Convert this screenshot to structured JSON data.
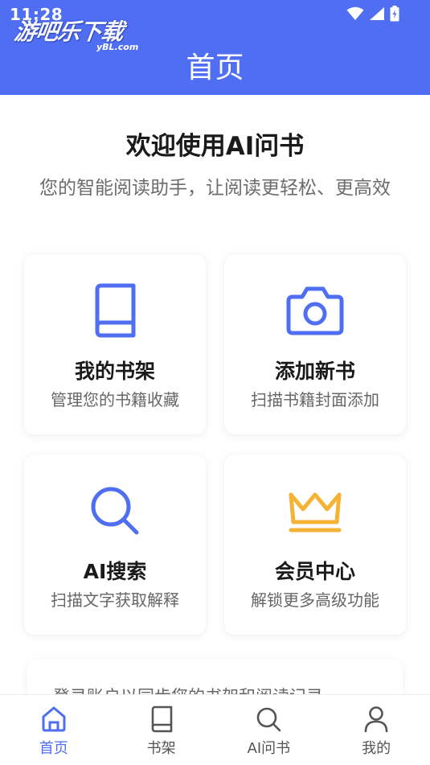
{
  "status_bar": {
    "time": "11:28",
    "watermark": "游吧乐下载",
    "watermark_sub": "yBL.com"
  },
  "header": {
    "title": "首页"
  },
  "welcome": {
    "title": "欢迎使用AI问书",
    "subtitle": "您的智能阅读助手，让阅读更轻松、更高效"
  },
  "cards": [
    {
      "icon": "book-icon",
      "title": "我的书架",
      "desc": "管理您的书籍收藏",
      "color": "#4f6ef2"
    },
    {
      "icon": "camera-icon",
      "title": "添加新书",
      "desc": "扫描书籍封面添加",
      "color": "#4f6ef2"
    },
    {
      "icon": "search-icon",
      "title": "AI搜索",
      "desc": "扫描文字获取解释",
      "color": "#4f6ef2"
    },
    {
      "icon": "crown-icon",
      "title": "会员中心",
      "desc": "解锁更多高级功能",
      "color": "#f5b335"
    }
  ],
  "login_prompt": "登录账户以同步您的书架和阅读记录",
  "bottom_nav": [
    {
      "icon": "home-icon",
      "label": "首页",
      "active": true
    },
    {
      "icon": "book-icon",
      "label": "书架",
      "active": false
    },
    {
      "icon": "search-icon",
      "label": "AI问书",
      "active": false
    },
    {
      "icon": "user-icon",
      "label": "我的",
      "active": false
    }
  ],
  "colors": {
    "primary": "#4f6ef2",
    "accent": "#f5b335",
    "inactive": "#555555"
  }
}
